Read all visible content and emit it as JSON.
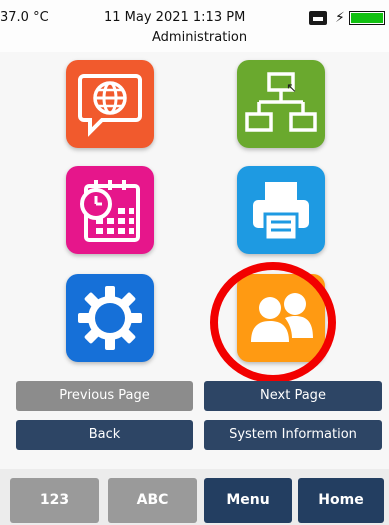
{
  "status_bar": {
    "temperature": "37.0 °C",
    "datetime": "11 May 2021 1:13 PM",
    "title": "Administration",
    "battery_level": 1.0,
    "battery_color": "#12c112"
  },
  "app_grid": [
    {
      "name": "internet",
      "icon": "globe-speech-icon",
      "color": "#f15a2d"
    },
    {
      "name": "network",
      "icon": "network-tree-icon",
      "color": "#6aa92e"
    },
    {
      "name": "calendar",
      "icon": "calendar-clock-icon",
      "color": "#e6168b"
    },
    {
      "name": "printer",
      "icon": "printer-icon",
      "color": "#1e9ae2"
    },
    {
      "name": "settings",
      "icon": "gear-icon",
      "color": "#1670d8"
    },
    {
      "name": "users",
      "icon": "users-icon",
      "color": "#ff9a12",
      "highlighted": true
    }
  ],
  "nav": {
    "previous_page": "Previous Page",
    "next_page": "Next Page",
    "back": "Back",
    "system_information": "System Information"
  },
  "bottom_bar": {
    "numeric": "123",
    "alpha": "ABC",
    "menu": "Menu",
    "home": "Home"
  },
  "colors": {
    "nav_dark": "#2d4565",
    "nav_disabled": "#8c8c8c",
    "highlight": "#f20000"
  }
}
